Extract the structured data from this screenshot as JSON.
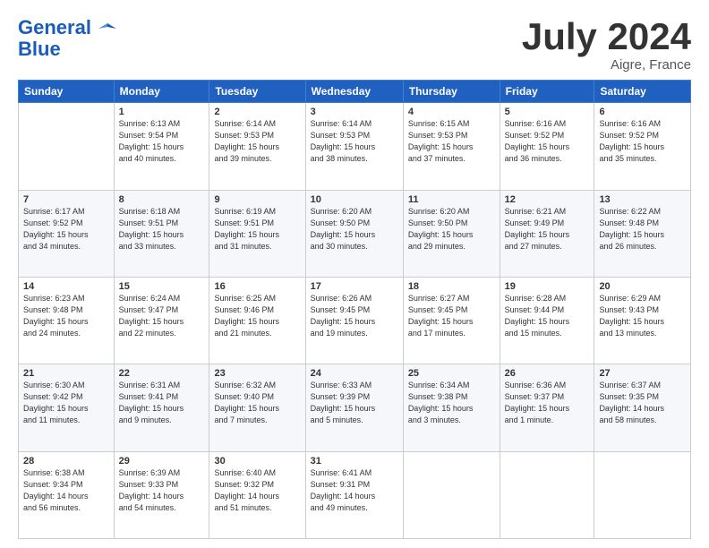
{
  "header": {
    "logo_line1": "General",
    "logo_line2": "Blue",
    "month": "July 2024",
    "location": "Aigre, France"
  },
  "columns": [
    "Sunday",
    "Monday",
    "Tuesday",
    "Wednesday",
    "Thursday",
    "Friday",
    "Saturday"
  ],
  "weeks": [
    [
      {
        "day": "",
        "info": ""
      },
      {
        "day": "1",
        "info": "Sunrise: 6:13 AM\nSunset: 9:54 PM\nDaylight: 15 hours\nand 40 minutes."
      },
      {
        "day": "2",
        "info": "Sunrise: 6:14 AM\nSunset: 9:53 PM\nDaylight: 15 hours\nand 39 minutes."
      },
      {
        "day": "3",
        "info": "Sunrise: 6:14 AM\nSunset: 9:53 PM\nDaylight: 15 hours\nand 38 minutes."
      },
      {
        "day": "4",
        "info": "Sunrise: 6:15 AM\nSunset: 9:53 PM\nDaylight: 15 hours\nand 37 minutes."
      },
      {
        "day": "5",
        "info": "Sunrise: 6:16 AM\nSunset: 9:52 PM\nDaylight: 15 hours\nand 36 minutes."
      },
      {
        "day": "6",
        "info": "Sunrise: 6:16 AM\nSunset: 9:52 PM\nDaylight: 15 hours\nand 35 minutes."
      }
    ],
    [
      {
        "day": "7",
        "info": "Sunrise: 6:17 AM\nSunset: 9:52 PM\nDaylight: 15 hours\nand 34 minutes."
      },
      {
        "day": "8",
        "info": "Sunrise: 6:18 AM\nSunset: 9:51 PM\nDaylight: 15 hours\nand 33 minutes."
      },
      {
        "day": "9",
        "info": "Sunrise: 6:19 AM\nSunset: 9:51 PM\nDaylight: 15 hours\nand 31 minutes."
      },
      {
        "day": "10",
        "info": "Sunrise: 6:20 AM\nSunset: 9:50 PM\nDaylight: 15 hours\nand 30 minutes."
      },
      {
        "day": "11",
        "info": "Sunrise: 6:20 AM\nSunset: 9:50 PM\nDaylight: 15 hours\nand 29 minutes."
      },
      {
        "day": "12",
        "info": "Sunrise: 6:21 AM\nSunset: 9:49 PM\nDaylight: 15 hours\nand 27 minutes."
      },
      {
        "day": "13",
        "info": "Sunrise: 6:22 AM\nSunset: 9:48 PM\nDaylight: 15 hours\nand 26 minutes."
      }
    ],
    [
      {
        "day": "14",
        "info": "Sunrise: 6:23 AM\nSunset: 9:48 PM\nDaylight: 15 hours\nand 24 minutes."
      },
      {
        "day": "15",
        "info": "Sunrise: 6:24 AM\nSunset: 9:47 PM\nDaylight: 15 hours\nand 22 minutes."
      },
      {
        "day": "16",
        "info": "Sunrise: 6:25 AM\nSunset: 9:46 PM\nDaylight: 15 hours\nand 21 minutes."
      },
      {
        "day": "17",
        "info": "Sunrise: 6:26 AM\nSunset: 9:45 PM\nDaylight: 15 hours\nand 19 minutes."
      },
      {
        "day": "18",
        "info": "Sunrise: 6:27 AM\nSunset: 9:45 PM\nDaylight: 15 hours\nand 17 minutes."
      },
      {
        "day": "19",
        "info": "Sunrise: 6:28 AM\nSunset: 9:44 PM\nDaylight: 15 hours\nand 15 minutes."
      },
      {
        "day": "20",
        "info": "Sunrise: 6:29 AM\nSunset: 9:43 PM\nDaylight: 15 hours\nand 13 minutes."
      }
    ],
    [
      {
        "day": "21",
        "info": "Sunrise: 6:30 AM\nSunset: 9:42 PM\nDaylight: 15 hours\nand 11 minutes."
      },
      {
        "day": "22",
        "info": "Sunrise: 6:31 AM\nSunset: 9:41 PM\nDaylight: 15 hours\nand 9 minutes."
      },
      {
        "day": "23",
        "info": "Sunrise: 6:32 AM\nSunset: 9:40 PM\nDaylight: 15 hours\nand 7 minutes."
      },
      {
        "day": "24",
        "info": "Sunrise: 6:33 AM\nSunset: 9:39 PM\nDaylight: 15 hours\nand 5 minutes."
      },
      {
        "day": "25",
        "info": "Sunrise: 6:34 AM\nSunset: 9:38 PM\nDaylight: 15 hours\nand 3 minutes."
      },
      {
        "day": "26",
        "info": "Sunrise: 6:36 AM\nSunset: 9:37 PM\nDaylight: 15 hours\nand 1 minute."
      },
      {
        "day": "27",
        "info": "Sunrise: 6:37 AM\nSunset: 9:35 PM\nDaylight: 14 hours\nand 58 minutes."
      }
    ],
    [
      {
        "day": "28",
        "info": "Sunrise: 6:38 AM\nSunset: 9:34 PM\nDaylight: 14 hours\nand 56 minutes."
      },
      {
        "day": "29",
        "info": "Sunrise: 6:39 AM\nSunset: 9:33 PM\nDaylight: 14 hours\nand 54 minutes."
      },
      {
        "day": "30",
        "info": "Sunrise: 6:40 AM\nSunset: 9:32 PM\nDaylight: 14 hours\nand 51 minutes."
      },
      {
        "day": "31",
        "info": "Sunrise: 6:41 AM\nSunset: 9:31 PM\nDaylight: 14 hours\nand 49 minutes."
      },
      {
        "day": "",
        "info": ""
      },
      {
        "day": "",
        "info": ""
      },
      {
        "day": "",
        "info": ""
      }
    ]
  ]
}
